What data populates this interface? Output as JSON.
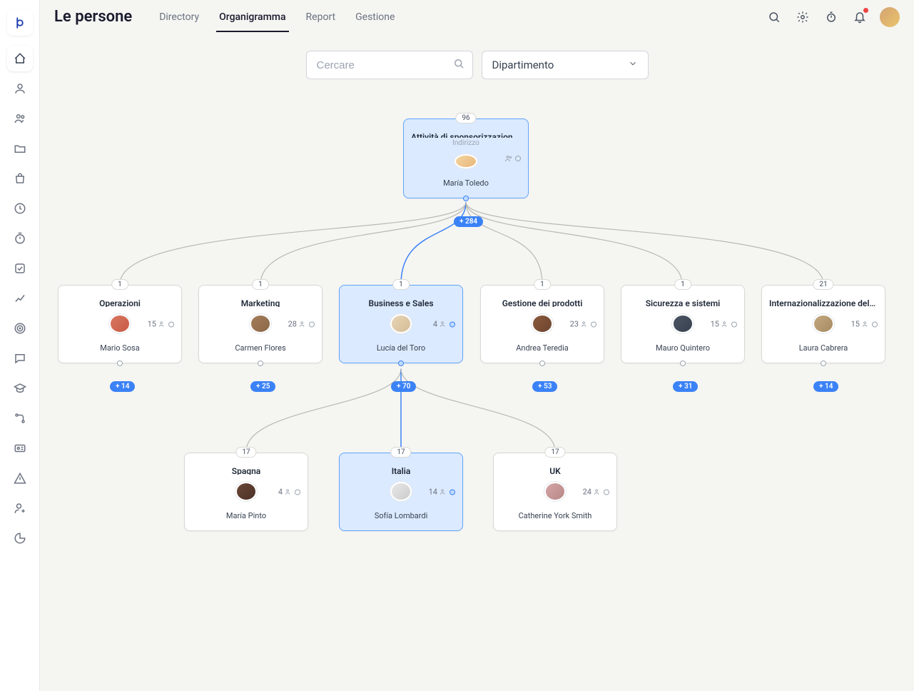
{
  "page_title": "Le persone",
  "tabs": {
    "t0": "Directory",
    "t1": "Organigramma",
    "t2": "Report",
    "t3": "Gestione"
  },
  "search": {
    "placeholder": "Cercare"
  },
  "select": {
    "label": "Dipartimento"
  },
  "root": {
    "badge": "96",
    "title": "Attività di sponsorizzazione ...",
    "subtitle": "Indirizzo",
    "name": "María Toledo",
    "expand": "+ 284",
    "avatar_bg": "linear-gradient(135deg,#f4d4a0,#e8b77a)"
  },
  "level1": {
    "c0": {
      "badge": "1",
      "title": "Operazioni",
      "count": "15",
      "name": "Mario Sosa",
      "expand": "+ 14",
      "avatar_bg": "linear-gradient(135deg,#d97762,#c85a44)"
    },
    "c1": {
      "badge": "1",
      "title": "Marketing",
      "count": "28",
      "name": "Carmen Flores",
      "expand": "+ 25",
      "avatar_bg": "linear-gradient(135deg,#a57d5a,#8b6848)"
    },
    "c2": {
      "badge": "1",
      "title": "Business e Sales",
      "count": "4",
      "name": "Lucía del Toro",
      "expand": "+ 70",
      "avatar_bg": "linear-gradient(135deg,#e8d5b7,#d4bc95)"
    },
    "c3": {
      "badge": "1",
      "title": "Gestione dei prodotti",
      "count": "23",
      "name": "Andrea Teredia",
      "expand": "+ 53",
      "avatar_bg": "linear-gradient(135deg,#8b5a3c,#6d4530)"
    },
    "c4": {
      "badge": "1",
      "title": "Sicurezza e sistemi",
      "count": "15",
      "name": "Mauro Quintero",
      "expand": "+ 31",
      "avatar_bg": "linear-gradient(135deg,#4b5563,#374151)"
    },
    "c5": {
      "badge": "21",
      "title": "Internazionalizzazione delle imp ...",
      "count": "15",
      "name": "Laura Cabrera",
      "expand": "+ 14",
      "avatar_bg": "linear-gradient(135deg,#c4a77d,#a68b63)"
    }
  },
  "level2": {
    "g0": {
      "badge": "17",
      "title": "Spagna",
      "count": "4",
      "name": "María Pinto",
      "avatar_bg": "linear-gradient(135deg,#6b4738,#4a3125)"
    },
    "g1": {
      "badge": "17",
      "title": "Italia",
      "count": "14",
      "name": "Sofía Lombardi",
      "avatar_bg": "linear-gradient(135deg,#e8e8e8,#cccccc)"
    },
    "g2": {
      "badge": "17",
      "title": "UK",
      "count": "24",
      "name": "Catherine York Smith",
      "avatar_bg": "linear-gradient(135deg,#d4a5a5,#b88787)"
    }
  }
}
